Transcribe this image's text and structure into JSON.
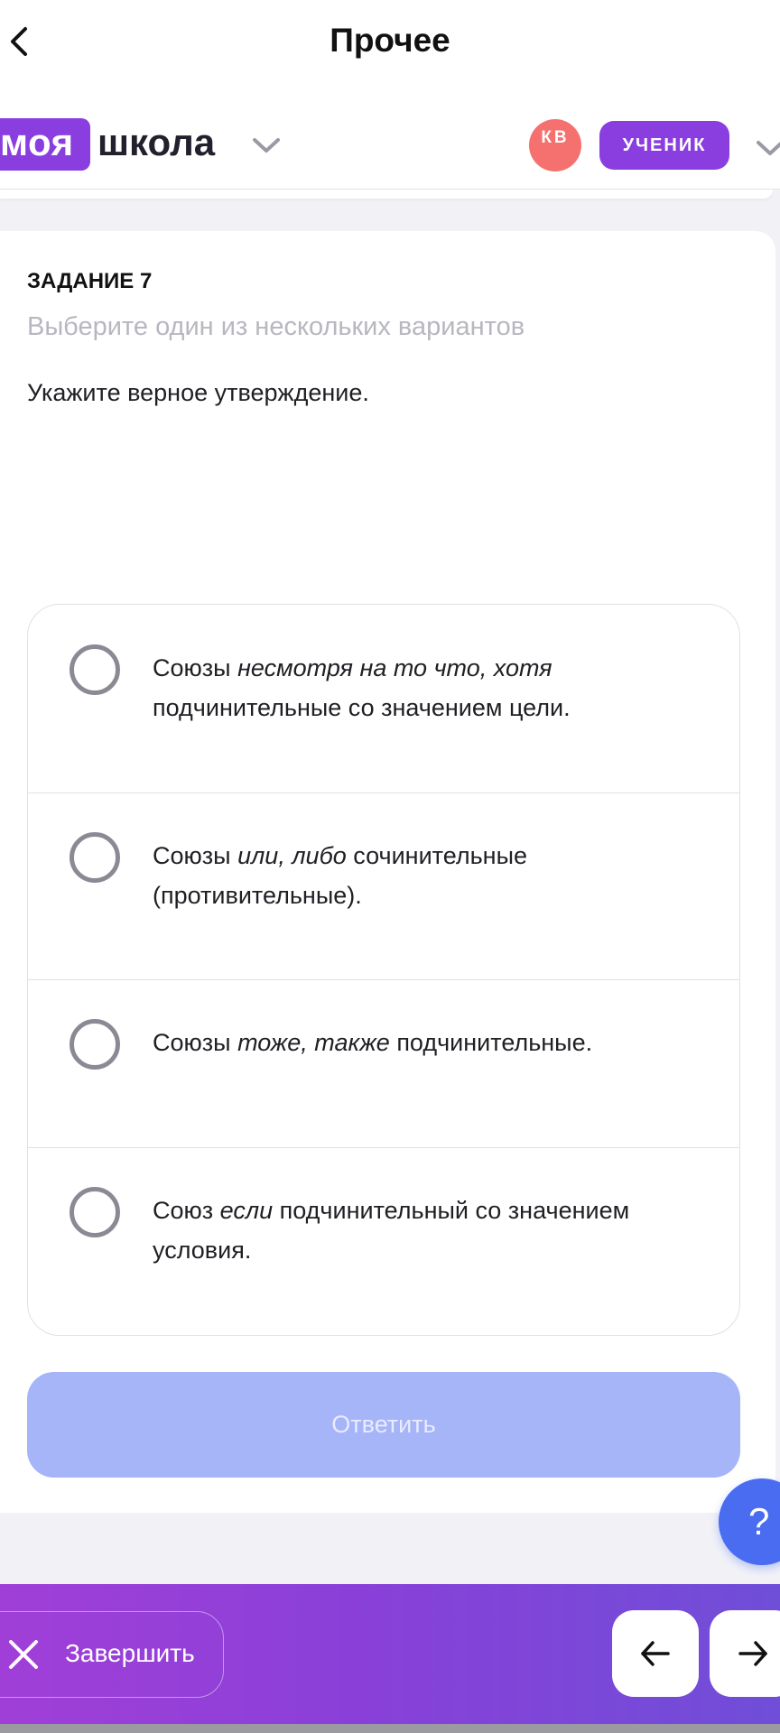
{
  "header": {
    "title": "Прочее"
  },
  "appbar": {
    "logo_part1": "моя",
    "logo_part2": "школа",
    "avatar_initials": "КВ",
    "role": "УЧЕНИК"
  },
  "task": {
    "number": "ЗАДАНИЕ 7",
    "hint": "Выберите один из нескольких вариантов",
    "question": "Укажите верное утверждение."
  },
  "options": [
    {
      "before": "Союзы ",
      "italic": "несмотря на то что, хотя",
      "after": " подчинительные со значением цели.",
      "selected": false
    },
    {
      "before": "Союзы ",
      "italic": "или, либо",
      "after": " сочинительные (противительные).",
      "selected": false
    },
    {
      "before": "Союзы ",
      "italic": "тоже, также",
      "after": " подчинительные.",
      "selected": false
    },
    {
      "before": "Союз ",
      "italic": "если",
      "after": " подчинительный со значением условия.",
      "selected": false
    }
  ],
  "answer_button": "Ответить",
  "help_button": "?",
  "bottombar": {
    "finish_label": "Завершить"
  },
  "colors": {
    "accent": "#8a3ee0",
    "answer_disabled": "#a6b4f8",
    "help": "#4a6cf0",
    "avatar": "#f4716f"
  },
  "icons": [
    "back-icon",
    "chevron-down-icon",
    "close-icon",
    "arrow-left-icon",
    "arrow-right-icon"
  ]
}
